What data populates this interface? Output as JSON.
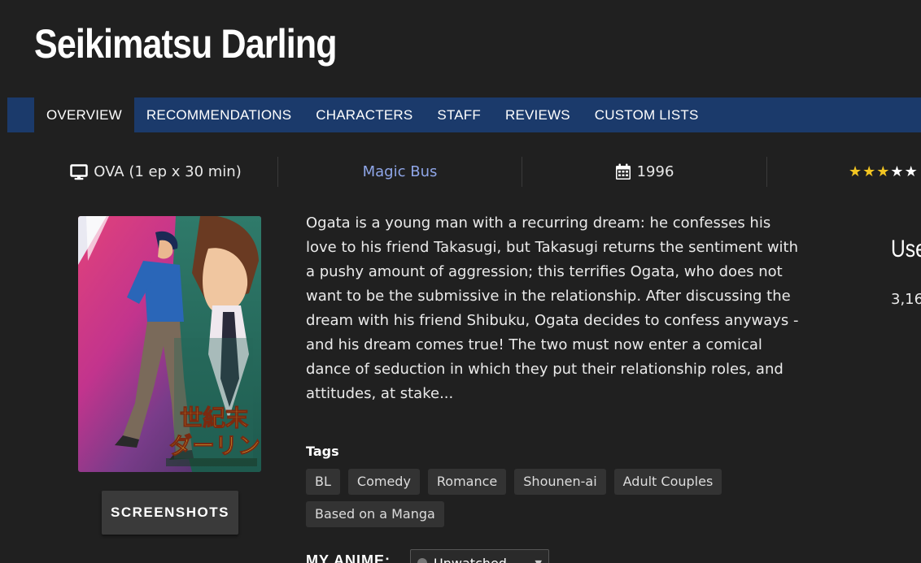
{
  "page": {
    "title": "Seikimatsu Darling"
  },
  "tabs": [
    {
      "label": "OVERVIEW",
      "active": true
    },
    {
      "label": "RECOMMENDATIONS",
      "active": false
    },
    {
      "label": "CHARACTERS",
      "active": false
    },
    {
      "label": "STAFF",
      "active": false
    },
    {
      "label": "REVIEWS",
      "active": false
    },
    {
      "label": "CUSTOM LISTS",
      "active": false
    }
  ],
  "info": {
    "type_icon": "monitor-icon",
    "type": "OVA (1 ep x 30 min)",
    "studio": "Magic Bus",
    "year_icon": "calendar-icon",
    "year": "1996",
    "rating_stars_filled": 3,
    "rating_stars_total": 5
  },
  "screenshots_label": "SCREENSHOTS",
  "synopsis": "Ogata is a young man with a recurring dream: he confesses his love to his friend Takasugi, but Takasugi returns the sentiment with a pushy amount of aggression; this terrifies Ogata, who does not want to be the submissive in the relationship. After discussing the dream with his friend Shibuku, Ogata decides to confess anyways - and his dream comes true! The two must now enter a comical dance of seduction in which they put their relationship roles, and attitudes, at stake...",
  "tags_heading": "Tags",
  "tags": [
    "BL",
    "Comedy",
    "Romance",
    "Shounen-ai",
    "Adult Couples",
    "Based on a Manga"
  ],
  "my_anime": {
    "label": "MY ANIME:",
    "status": "Unwatched"
  },
  "sidebar": {
    "heading": "Use",
    "count": "3,16"
  },
  "colors": {
    "background": "#202020",
    "tab_bar": "#1b3a6b",
    "studio_link": "#8fa6e8",
    "star_filled": "#f2c522",
    "star_empty": "#ffffff"
  }
}
